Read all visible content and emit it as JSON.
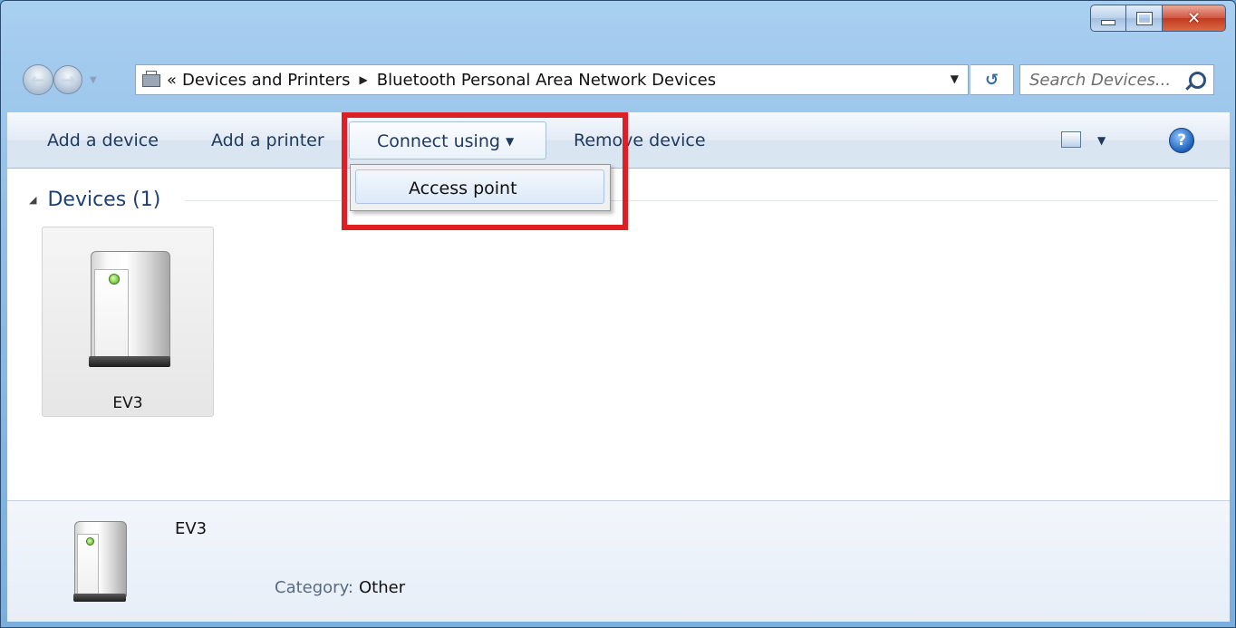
{
  "address": {
    "overflow": "«",
    "crumbs": [
      "Devices and Printers",
      "Bluetooth Personal Area Network Devices"
    ]
  },
  "search": {
    "placeholder": "Search Devices..."
  },
  "toolbar": {
    "add_device": "Add a device",
    "add_printer": "Add a printer",
    "connect_using": "Connect using",
    "remove_device": "Remove device"
  },
  "menu": {
    "items": [
      "Access point"
    ]
  },
  "group": {
    "title": "Devices (1)"
  },
  "devices": [
    {
      "name": "EV3"
    }
  ],
  "details": {
    "name": "EV3",
    "category_label": "Category:",
    "category_value": "Other"
  },
  "colors": {
    "highlight": "#e01e26",
    "group_title": "#1e3f76"
  }
}
